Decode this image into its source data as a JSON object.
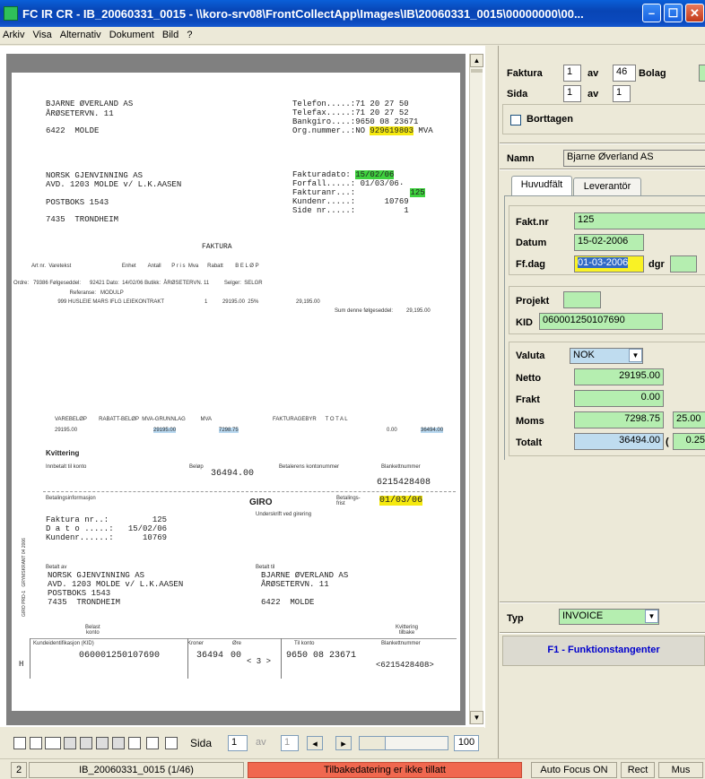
{
  "window": {
    "title": "FC IR CR  -  IB_20060331_0015  -  \\\\koro-srv08\\FrontCollectApp\\Images\\IB\\20060331_0015\\00000000\\00..."
  },
  "menu": [
    "Arkiv",
    "Visa",
    "Alternativ",
    "Dokument",
    "Bild",
    "?"
  ],
  "document": {
    "seller_name": "BJARNE ØVERLAND AS",
    "seller_street": "ÅRØSETERVN. 11",
    "seller_city": "6422  MOLDE",
    "phone": "Telefon.....:71 20 27 50",
    "fax": "Telefax.....:71 20 27 52",
    "bankgiro": "Bankgiro....:9650 08 23671",
    "orgnr_label": "Org.nummer..:NO ",
    "orgnr_value": "929619803",
    "orgnr_suffix": " MVA",
    "buyer_name": "NORSK GJENVINNING AS",
    "buyer_addr": "AVD. 1203 MOLDE v/ L.K.AASEN",
    "buyer_box": "POSTBOKS 1543",
    "buyer_city": "7435  TRONDHEIM",
    "fakturadato_label": "Fakturadato: ",
    "fakturadato_value": "15/02/06",
    "forfall": "Forfall.....: 01/03/06",
    "fakturanr_label": "Fakturanr...: ",
    "fakturanr_value": "125",
    "kundenr": "Kundenr.....:      10769",
    "side": "Side nr.....:          1",
    "heading": "FAKTURA",
    "col_headers": "Art nr.  Varetekst                                  Enhet        Antall       P r i s  Mva      Rabatt        B E L Ø P",
    "order_line": "Ordre:   79386 Følgeseddel:      92421 Dato:  14/02/06 Butikk:  ÅRØSETERVN. 11          Selger:  SELGR",
    "reference_line": "                Referanse:   MODULP",
    "item_line": "        999 HUSLEIE MARS IFLG LEIEKONTRAKT                           1          29195.00  25%                         29,195.00",
    "sum_line": "Sum denne følgeseddel:         29,195.00",
    "totals_headers": "VAREBELØP        RABATT-BELØP  MVA-GRUNNLAG          MVA                                         FAKTURAGEBYR      T O T A L",
    "totals_varebelop": "29195.00",
    "totals_grunnlag": "29195.00",
    "totals_mva": "7298.75",
    "totals_gebyr": "0.00",
    "totals_total": "36494.00",
    "kvittering": "Kvittering",
    "innbetalt": "Innbetalt til konto",
    "belop_label": "Beløp",
    "belop_value": "36494.00",
    "betalers_konto": "Betalerens kontonummer",
    "blankettnr_label": "Blankettnummer",
    "blankettnr_value": "6215428408",
    "betalingsinfo": "Betalingsinformasjon",
    "giro": "GIRO",
    "betalingsfrist": "Betalings-\nfrist",
    "frist_value": "01/03/06",
    "underskrift": "Underskrift ved girering",
    "gi_fakturanr": "Faktura nr..:         125",
    "gi_dato": "D a t o .....:   15/02/06",
    "gi_kundenr": "Kundenr......:      10769",
    "betalt_av": "Betalt av",
    "betalt_til": "Betalt til",
    "gi_buyer_name": "NORSK GJENVINNING AS",
    "gi_buyer_addr": "AVD. 1203 MOLDE v/ L.K.AASEN",
    "gi_buyer_box": "POSTBOKS 1543",
    "gi_buyer_city": "7435  TRONDHEIM",
    "gi_seller_name": "BJARNE ØVERLAND AS",
    "gi_seller_street": "ÅRØSETERVN. 11",
    "gi_seller_city": "6422  MOLDE",
    "belast_konto": "Belast\nkonto",
    "kvittering_tilbake": "Kvittering\ntilbake",
    "kid_label": "Kundeidentifikasjon (KID)",
    "kroner_label": "Kroner",
    "ore_label": "Øre",
    "tilkonto_label": "Til konto",
    "blankett_label2": "Blankettnummer",
    "kid_value": "060001250107690",
    "kroner_value": "36494",
    "ore_value": "00",
    "check_digit": "< 3 >",
    "tilkonto_value": "9650 08 23671",
    "blankett_value2": "<6215428408>",
    "h_mark": "H",
    "side_text": "GIRO PRD-1   GRYMSKRANT 04 2006",
    "dot": "·"
  },
  "bottombar": {
    "sida_label": "Sida",
    "sida_value": "1",
    "av_label": "av",
    "av_value": "1",
    "zoom_value": "100"
  },
  "status": {
    "batch": "IB_20060331_0015 (1/46)",
    "warning": "Tilbakedatering er ikke tillatt",
    "autofocus": "Auto Focus ON",
    "rect": "Rect",
    "mus": "Mus",
    "left_num": "2",
    "warning_color": "#f0684f"
  },
  "panel": {
    "faktura_label": "Faktura",
    "faktura_value": "1",
    "faktura_av": "av",
    "faktura_total": "46",
    "bolag_label": "Bolag",
    "sida_label": "Sida",
    "sida_value": "1",
    "sida_av": "av",
    "sida_total": "1",
    "borttagen_label": "Borttagen",
    "namn_label": "Namn",
    "namn_value": "Bjarne Øverland AS",
    "tabs": [
      "Huvudfält",
      "Leverantör"
    ],
    "faktnr_label": "Fakt.nr",
    "faktnr_value": "125",
    "datum_label": "Datum",
    "datum_value": "15-02-2006",
    "ffdag_label": "Ff.dag",
    "ffdag_value": "01-03-2006",
    "dgr_label": "dgr",
    "dgr_value": "",
    "projekt_label": "Projekt",
    "projekt_value": "",
    "kid_label": "KID",
    "kid_value": "060001250107690",
    "valuta_label": "Valuta",
    "valuta_value": "NOK",
    "netto_label": "Netto",
    "netto_value": "29195.00",
    "frakt_label": "Frakt",
    "frakt_value": "0.00",
    "moms_label": "Moms",
    "moms_value": "7298.75",
    "moms_rate": "25.00",
    "totalt_label": "Totalt",
    "totalt_value": "36494.00",
    "totalt_paren": "(",
    "totalt_round": "0.25",
    "typ_label": "Typ",
    "typ_value": "INVOICE",
    "f1_label": "F1 - Funktionstangenter",
    "f1_color": "#0000cc"
  }
}
